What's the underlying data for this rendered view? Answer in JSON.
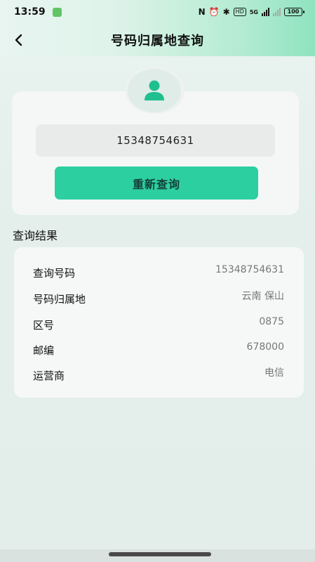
{
  "status_bar": {
    "time": "13:59",
    "nfc": "N",
    "alarm": "⏰",
    "bluetooth": "✱",
    "hd": "HD",
    "network": "5G",
    "battery": "100"
  },
  "nav": {
    "title": "号码归属地查询",
    "back_icon": "chevron-left-icon"
  },
  "query": {
    "phone_value": "15348754631",
    "avatar_icon": "user-icon",
    "button_label": "重新查询"
  },
  "results": {
    "title": "查询结果",
    "rows": [
      {
        "label": "查询号码",
        "value": "15348754631"
      },
      {
        "label": "号码归属地",
        "value": "云南 保山"
      },
      {
        "label": "区号",
        "value": "0875"
      },
      {
        "label": "邮编",
        "value": "678000"
      },
      {
        "label": "运营商",
        "value": "电信"
      }
    ]
  },
  "colors": {
    "accent": "#2ccfa0",
    "avatar_icon": "#1fbf8f"
  }
}
